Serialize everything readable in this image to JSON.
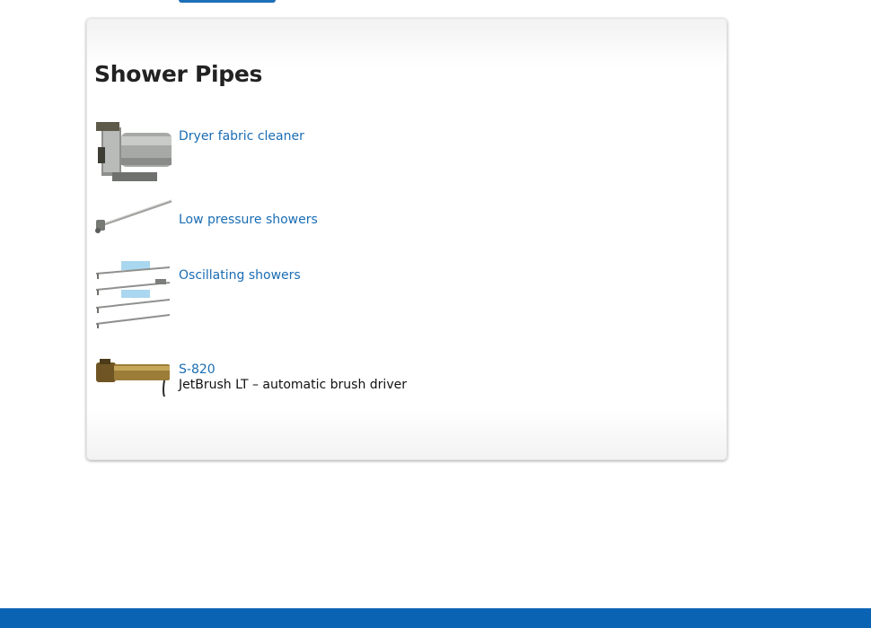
{
  "panel": {
    "title": "Shower Pipes"
  },
  "products": [
    {
      "link_label": "Dryer fabric cleaner",
      "description": "",
      "image": "dryer-fabric-cleaner-photo"
    },
    {
      "link_label": "Low pressure showers",
      "description": "",
      "image": "low-pressure-shower-photo"
    },
    {
      "link_label": "Oscillating showers",
      "description": "",
      "image": "oscillating-showers-photo"
    },
    {
      "link_label": "S-820",
      "description": "JetBrush LT – automatic brush driver",
      "image": "jetbrush-photo"
    }
  ],
  "colors": {
    "link": "#1a6db4",
    "footer": "#0b63b3",
    "top_button": "#1f6fb8"
  }
}
